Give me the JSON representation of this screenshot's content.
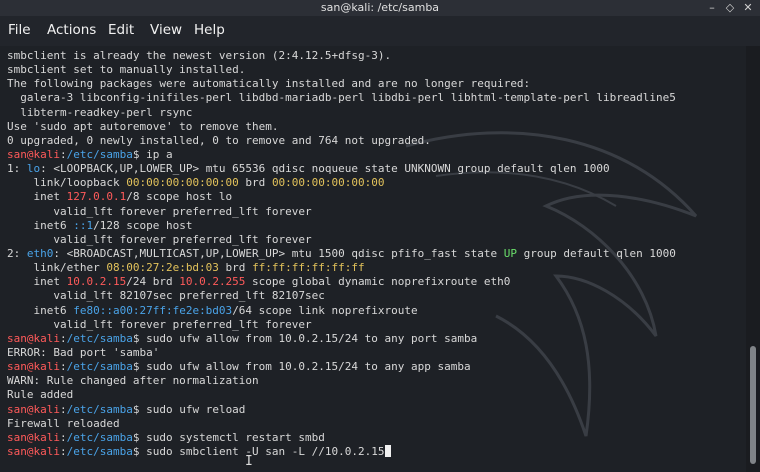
{
  "window": {
    "title": "san@kali: /etc/samba"
  },
  "menu": {
    "items": [
      "File",
      "Actions",
      "Edit",
      "View",
      "Help"
    ]
  },
  "terminal": {
    "l0": "smbclient is already the newest version (2:4.12.5+dfsg-3).",
    "l1": "smbclient set to manually installed.",
    "l2": "The following packages were automatically installed and are no longer required:",
    "l3": "  galera-3 libconfig-inifiles-perl libdbd-mariadb-perl libdbi-perl libhtml-template-perl libreadline5",
    "l4": "  libterm-readkey-perl rsync",
    "l5": "Use 'sudo apt autoremove' to remove them.",
    "l6": "0 upgraded, 0 newly installed, 0 to remove and 764 not upgraded.",
    "prompt_user": "san@kali",
    "prompt_sep": ":",
    "prompt_path": "/etc/samba",
    "prompt_end": "$ ",
    "l7_cmd": "ip a",
    "l8_a": "1: ",
    "l8_b": "lo",
    "l8_c": ": <LOOPBACK,UP,LOWER_UP> mtu 65536 qdisc noqueue state UNKNOWN group default qlen 1000",
    "l9_a": "    link/loopback ",
    "l9_b": "00:00:00:00:00:00",
    "l9_c": " brd ",
    "l9_d": "00:00:00:00:00:00",
    "l10_a": "    inet ",
    "l10_b": "127.0.0.1",
    "l10_c": "/8 scope host lo",
    "l11": "       valid_lft forever preferred_lft forever",
    "l12_a": "    inet6 ",
    "l12_b": "::1",
    "l12_c": "/128 scope host",
    "l13": "       valid_lft forever preferred_lft forever",
    "l14_a": "2: ",
    "l14_b": "eth0",
    "l14_c": ": <BROADCAST,MULTICAST,UP,LOWER_UP> mtu 1500 qdisc pfifo_fast state ",
    "l14_d": "UP",
    "l14_e": " group default qlen 1000",
    "l15_a": "    link/ether ",
    "l15_b": "08:00:27:2e:bd:03",
    "l15_c": " brd ",
    "l15_d": "ff:ff:ff:ff:ff:ff",
    "l16_a": "    inet ",
    "l16_b": "10.0.2.15",
    "l16_c": "/24 brd ",
    "l16_d": "10.0.2.255",
    "l16_e": " scope global dynamic noprefixroute eth0",
    "l17": "       valid_lft 82107sec preferred_lft 82107sec",
    "l18_a": "    inet6 ",
    "l18_b": "fe80::a00:27ff:fe2e:bd03",
    "l18_c": "/64 scope link noprefixroute",
    "l19": "       valid_lft forever preferred_lft forever",
    "l20_cmd": "sudo ufw allow from 10.0.2.15/24 to any port samba",
    "l21": "ERROR: Bad port 'samba'",
    "l22_cmd": "sudo ufw allow from 10.0.2.15/24 to any app samba",
    "l23": "WARN: Rule changed after normalization",
    "l24": "Rule added",
    "l25_cmd": "sudo ufw reload",
    "l26": "Firewall reloaded",
    "l27_cmd": "sudo systemctl restart smbd",
    "l28_cmd": "sudo smbclient -U san -L //10.0.2.15"
  },
  "colors": {
    "prompt": "#ff5a5a",
    "path": "#4aa3e8",
    "mac": "#e2c25b",
    "state_up": "#6adf6a",
    "background": "#1e2126"
  }
}
